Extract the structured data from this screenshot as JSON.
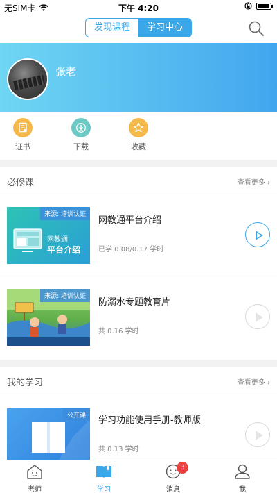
{
  "status_bar": {
    "carrier": "无SIM卡",
    "time": "下午 4:20"
  },
  "header": {
    "tabs": [
      {
        "label": "发现课程",
        "active": false
      },
      {
        "label": "学习中心",
        "active": true
      }
    ],
    "search_icon": "search-icon"
  },
  "profile": {
    "name": "张老"
  },
  "quick_actions": [
    {
      "label": "证书",
      "icon": "certificate-icon",
      "color": "#f5b84a"
    },
    {
      "label": "下载",
      "icon": "download-icon",
      "color": "#6cc9c4"
    },
    {
      "label": "收藏",
      "icon": "star-icon",
      "color": "#f5b84a"
    }
  ],
  "required": {
    "title": "必修课",
    "more": "查看更多",
    "courses": [
      {
        "title": "网教通平台介绍",
        "meta": "已学 0.08/0.17 学时",
        "tag": "来源: 培训认证",
        "thumb_line1": "网教通",
        "thumb_line2": "平台介绍",
        "playing": true
      },
      {
        "title": "防溺水专题教育片",
        "meta": "共 0.16 学时",
        "tag": "来源: 培训认证",
        "playing": false
      }
    ]
  },
  "my_learning": {
    "title": "我的学习",
    "more": "查看更多",
    "courses": [
      {
        "title": "学习功能使用手册-教师版",
        "meta": "共 0.13 学时",
        "tag": "公开课",
        "playing": false
      }
    ]
  },
  "tabbar": {
    "items": [
      {
        "label": "老师",
        "icon": "teacher-home-icon",
        "active": false
      },
      {
        "label": "学习",
        "icon": "book-icon",
        "active": true
      },
      {
        "label": "消息",
        "icon": "message-icon",
        "active": false,
        "badge": "3"
      },
      {
        "label": "我",
        "icon": "user-icon",
        "active": false
      }
    ]
  },
  "colors": {
    "accent": "#3aa8e8",
    "badge": "#e94040"
  }
}
